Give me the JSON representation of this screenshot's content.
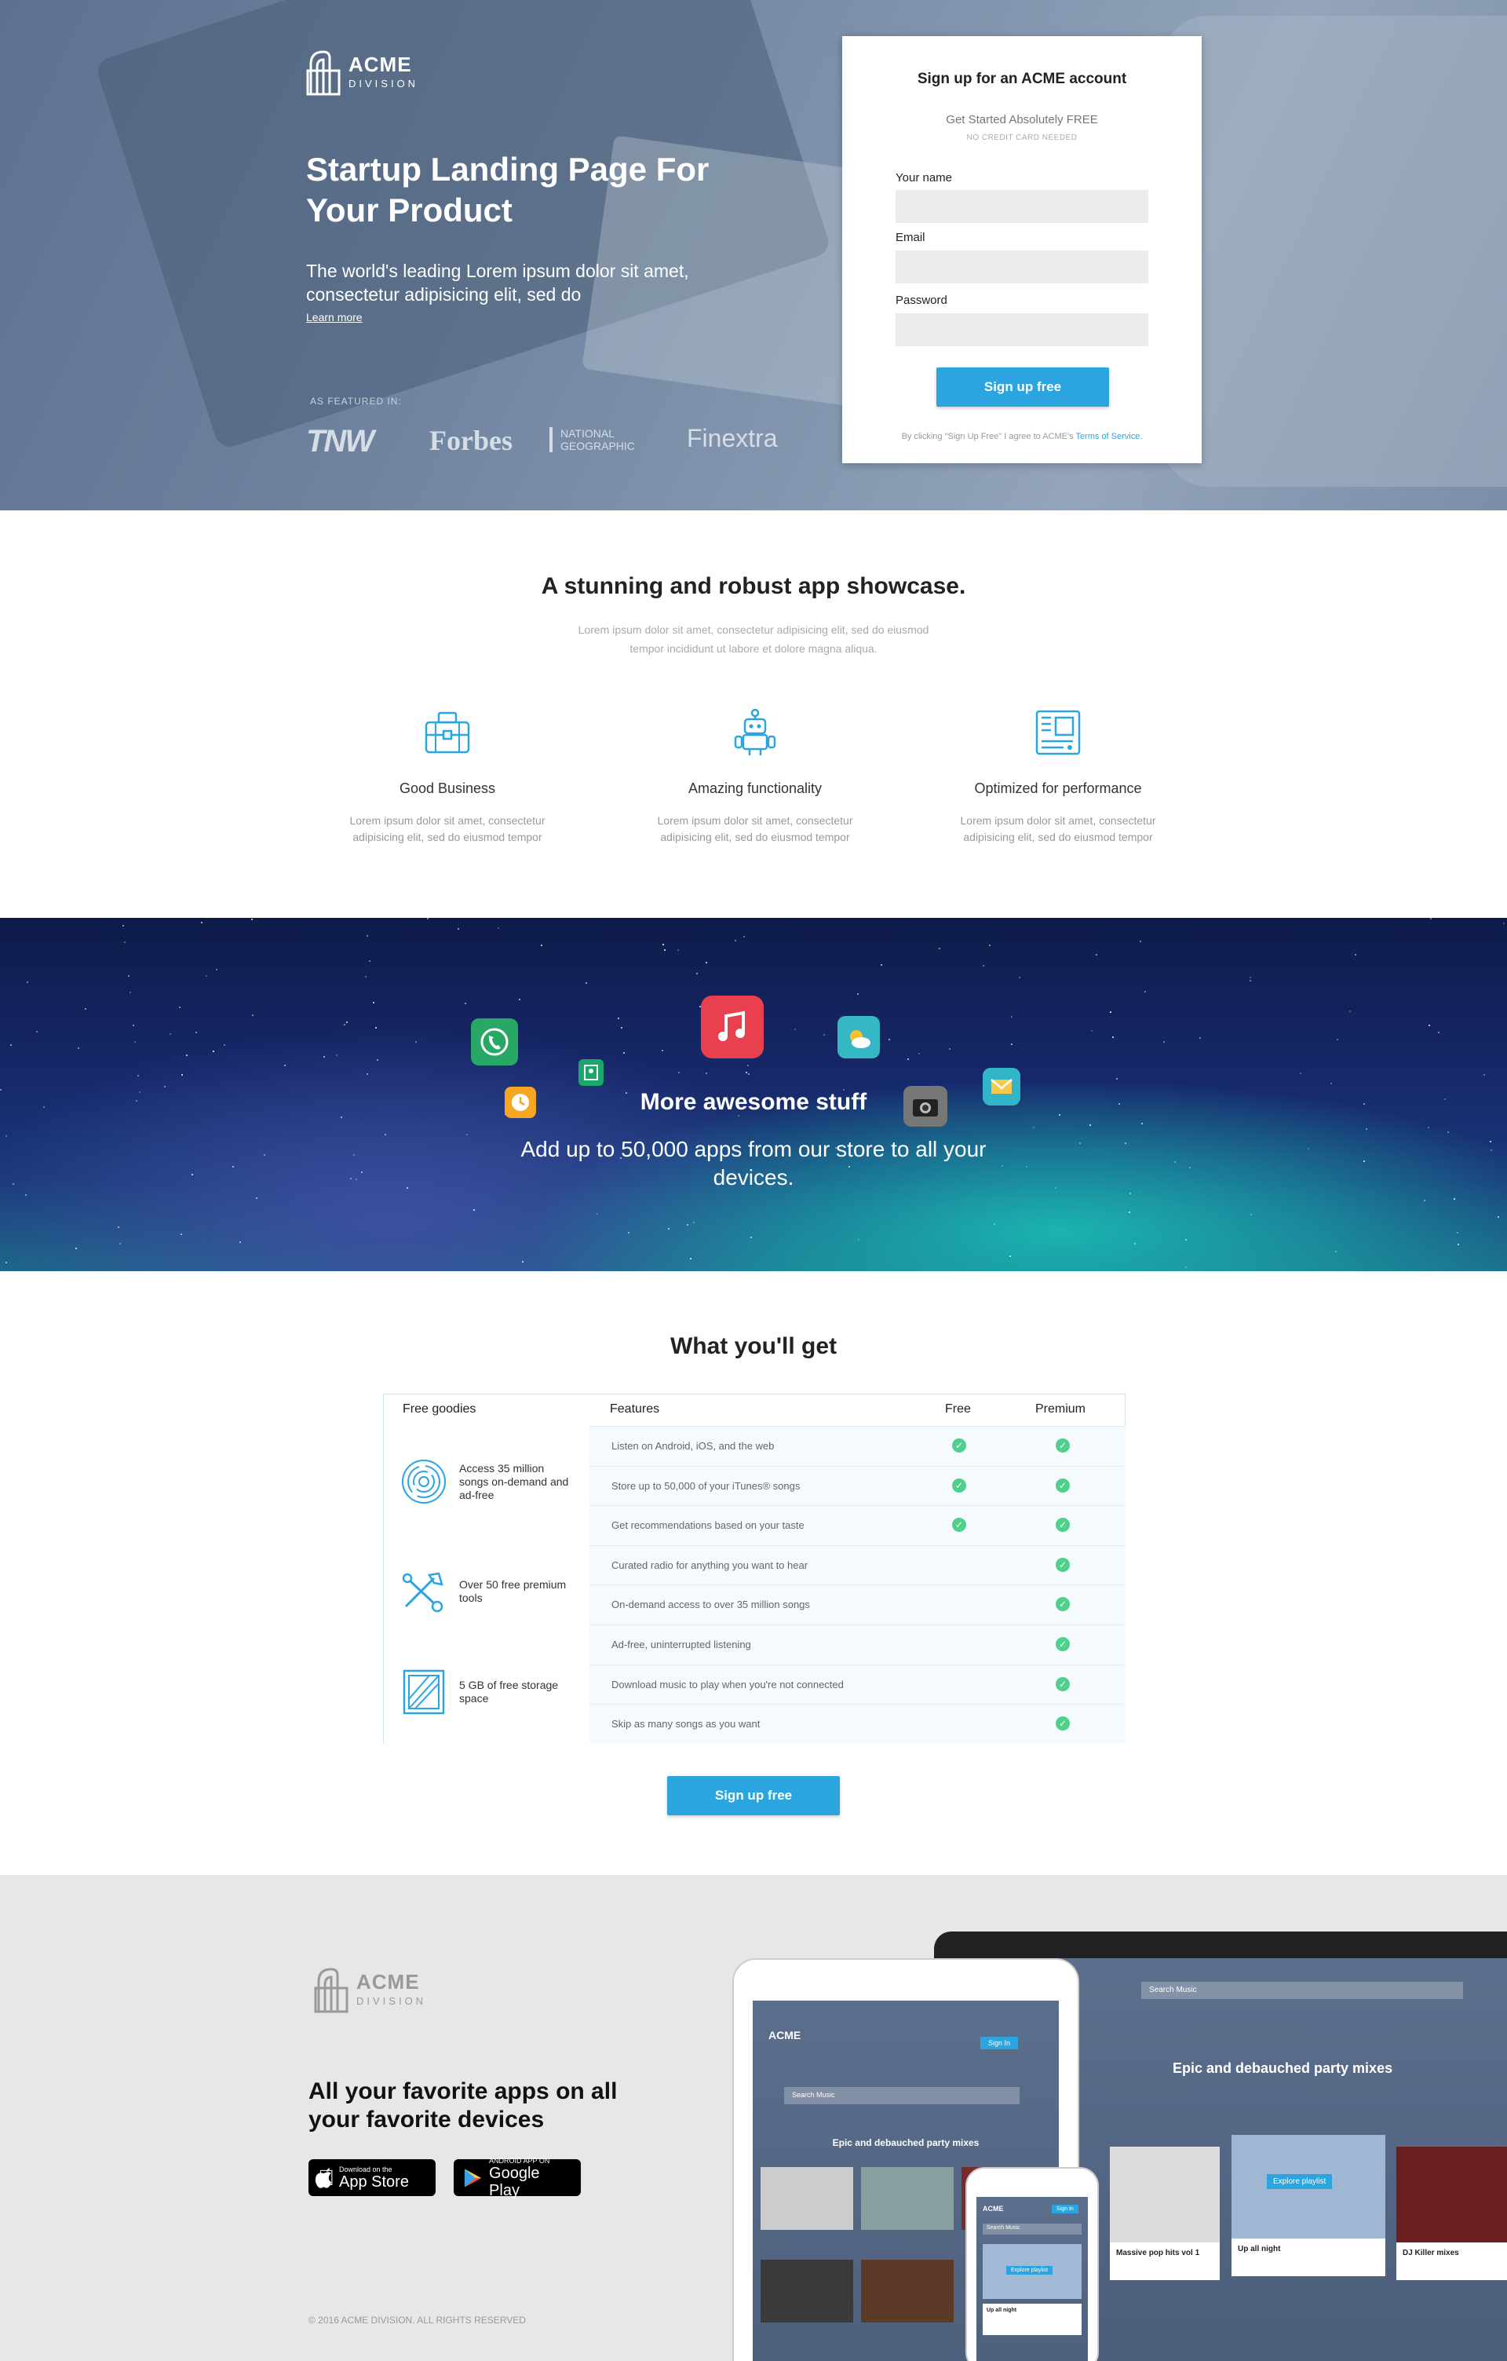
{
  "hero": {
    "logo": {
      "name": "ACME",
      "sub": "DIVISION"
    },
    "headline": "Startup Landing Page For Your Product",
    "lede": "The world's leading Lorem ipsum dolor sit amet, consectetur adipisicing elit, sed do",
    "learn_more": "Learn more",
    "featured_label": "AS FEATURED IN:",
    "press": [
      "TNW",
      "Forbes",
      "NATIONAL GEOGRAPHIC",
      "Finextra"
    ]
  },
  "signup": {
    "title": "Sign up for an ACME account",
    "tagline": "Get Started Absolutely FREE",
    "note": "NO CREDIT CARD NEEDED",
    "name_label": "Your name",
    "email_label": "Email",
    "password_label": "Password",
    "button": "Sign up free",
    "terms_prefix": "By clicking \"Sign Up Free\" I agree to ACME's",
    "terms_link": "Terms of Service."
  },
  "showcase": {
    "title": "A stunning and robust app showcase.",
    "subtitle": "Lorem ipsum dolor sit amet, consectetur adipisicing elit, sed do eiusmod tempor incididunt ut labore et dolore magna aliqua.",
    "features": [
      {
        "title": "Good Business",
        "desc": "Lorem ipsum dolor sit amet, consectetur adipisicing elit, sed do eiusmod tempor",
        "icon": "briefcase-icon"
      },
      {
        "title": "Amazing functionality",
        "desc": "Lorem ipsum dolor sit amet, consectetur adipisicing elit, sed do eiusmod tempor",
        "icon": "robot-icon"
      },
      {
        "title": "Optimized for performance",
        "desc": "Lorem ipsum dolor sit amet, consectetur adipisicing elit, sed do eiusmod tempor",
        "icon": "circuit-board-icon"
      }
    ]
  },
  "space": {
    "title": "More awesome stuff",
    "desc": "Add up to 50,000 apps from our store to all your devices.",
    "icons": [
      "phone-icon",
      "music-icon",
      "weather-icon",
      "mail-icon",
      "camera-icon",
      "clock-icon",
      "maps-icon"
    ]
  },
  "get": {
    "title": "What you'll get",
    "headers": {
      "goodies": "Free goodies",
      "features": "Features",
      "free": "Free",
      "premium": "Premium"
    },
    "goodies": [
      {
        "text": "Access 35 million songs on-demand and ad-free",
        "icon": "fingerprint-icon"
      },
      {
        "text": "Over 50 free premium tools",
        "icon": "tools-icon"
      },
      {
        "text": "5 GB of free storage space",
        "icon": "storage-icon"
      }
    ],
    "rows": [
      {
        "text": "Listen on Android, iOS, and the web",
        "free": true,
        "premium": true
      },
      {
        "text": "Store up to 50,000 of your iTunes® songs",
        "free": true,
        "premium": true
      },
      {
        "text": "Get recommendations based on your taste",
        "free": true,
        "premium": true
      },
      {
        "text": "Curated radio for anything you want to hear",
        "free": false,
        "premium": true
      },
      {
        "text": "On-demand access to over 35 million songs",
        "free": false,
        "premium": true
      },
      {
        "text": "Ad-free, uninterrupted listening",
        "free": false,
        "premium": true
      },
      {
        "text": "Download music to play when you're not connected",
        "free": false,
        "premium": true
      },
      {
        "text": "Skip as many songs as you want",
        "free": false,
        "premium": true
      }
    ],
    "button": "Sign up free"
  },
  "footer": {
    "logo": {
      "name": "ACME",
      "sub": "DIVISION"
    },
    "headline": "All your favorite apps on all your favorite devices",
    "appstore": {
      "small": "Download on the",
      "big": "App Store"
    },
    "googleplay": {
      "small": "ANDROID APP ON",
      "big": "Google Play"
    },
    "copyright": "© 2016 ACME DIVISION. ALL RIGHTS RESERVED",
    "mock": {
      "search": "Search Music",
      "banner": "Epic and debauched party mixes",
      "signin": "Sign In",
      "explore": "Explore playlist",
      "cards": [
        "Massive pop hits vol 1",
        "Up all night",
        "DJ Killer mixes"
      ]
    }
  },
  "colors": {
    "accent": "#2aa5e0",
    "check": "#4fd08b",
    "icon_blue": "#2aa5e0"
  }
}
